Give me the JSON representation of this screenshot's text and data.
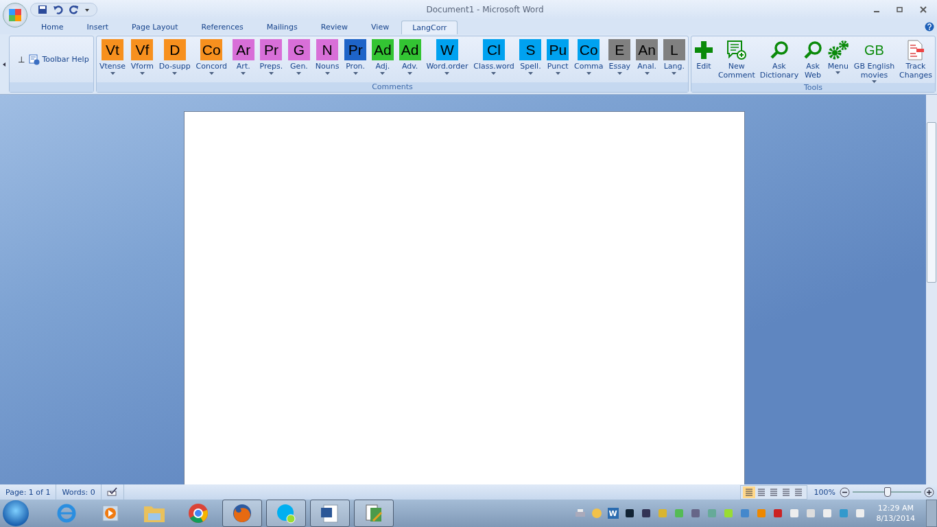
{
  "window": {
    "title": "Document1 - Microsoft Word"
  },
  "tabs": [
    {
      "label": "Home",
      "selected": false
    },
    {
      "label": "Insert",
      "selected": false
    },
    {
      "label": "Page Layout",
      "selected": false
    },
    {
      "label": "References",
      "selected": false
    },
    {
      "label": "Mailings",
      "selected": false
    },
    {
      "label": "Review",
      "selected": false
    },
    {
      "label": "View",
      "selected": false
    },
    {
      "label": "LangCorr",
      "selected": true
    }
  ],
  "help_group": {
    "marker": "⊥",
    "button": "Toolbar Help"
  },
  "comments_group": {
    "label": "Comments",
    "items": [
      {
        "abbr": "Vt",
        "label": "Vtense",
        "color": "#f7901e"
      },
      {
        "abbr": "Vf",
        "label": "Vform",
        "color": "#f7901e"
      },
      {
        "abbr": "D",
        "label": "Do-supp",
        "color": "#f7901e"
      },
      {
        "abbr": "Co",
        "label": "Concord",
        "color": "#f7901e"
      },
      {
        "abbr": "Ar",
        "label": "Art.",
        "color": "#d86fd8"
      },
      {
        "abbr": "Pr",
        "label": "Preps.",
        "color": "#d86fd8"
      },
      {
        "abbr": "G",
        "label": "Gen.",
        "color": "#d86fd8"
      },
      {
        "abbr": "N",
        "label": "Nouns",
        "color": "#d86fd8"
      },
      {
        "abbr": "Pr",
        "label": "Pron.",
        "color": "#1e64c8"
      },
      {
        "abbr": "Ad",
        "label": "Adj.",
        "color": "#33c433"
      },
      {
        "abbr": "Ad",
        "label": "Adv.",
        "color": "#33c433"
      },
      {
        "abbr": "W",
        "label": "Word.order",
        "color": "#00a2f0"
      },
      {
        "abbr": "Cl",
        "label": "Class.word",
        "color": "#00a2f0"
      },
      {
        "abbr": "S",
        "label": "Spell.",
        "color": "#00a2f0"
      },
      {
        "abbr": "Pu",
        "label": "Punct",
        "color": "#00a2f0"
      },
      {
        "abbr": "Co",
        "label": "Comma",
        "color": "#00a2f0"
      },
      {
        "abbr": "E",
        "label": "Essay",
        "color": "#808080"
      },
      {
        "abbr": "An",
        "label": "Anal.",
        "color": "#808080"
      },
      {
        "abbr": "L",
        "label": "Lang.",
        "color": "#808080"
      }
    ]
  },
  "tools_group": {
    "label": "Tools",
    "items": [
      {
        "kind": "plus",
        "lines": [
          "Edit"
        ],
        "dropdown": false
      },
      {
        "kind": "comment",
        "lines": [
          "New",
          "Comment"
        ],
        "dropdown": false
      },
      {
        "kind": "magnifier",
        "lines": [
          "Ask",
          "Dictionary"
        ],
        "dropdown": false
      },
      {
        "kind": "magnifier",
        "lines": [
          "Ask",
          "Web"
        ],
        "dropdown": false
      },
      {
        "kind": "gears",
        "lines": [
          "Menu"
        ],
        "dropdown": true
      },
      {
        "kind": "text",
        "glyph": "GB",
        "lines": [
          "GB English",
          "movies"
        ],
        "dropdown": true
      },
      {
        "kind": "document",
        "lines": [
          "Track",
          "Changes"
        ],
        "dropdown": false
      }
    ]
  },
  "status_bar": {
    "page": "Page: 1 of 1",
    "words": "Words: 0",
    "views": [
      {
        "selected": true
      },
      {
        "selected": false
      },
      {
        "selected": false
      },
      {
        "selected": false
      },
      {
        "selected": false
      }
    ],
    "zoom": "100%",
    "zoom_slider": {
      "level": 0.5
    }
  },
  "taskbar": {
    "apps": [
      {
        "kind": "browser-e",
        "running": false
      },
      {
        "kind": "media",
        "running": false
      },
      {
        "kind": "folder",
        "running": false
      },
      {
        "kind": "chrome",
        "running": false
      },
      {
        "kind": "fox",
        "running": true
      },
      {
        "kind": "chat",
        "running": true
      },
      {
        "kind": "word",
        "running": true
      },
      {
        "kind": "notebook",
        "running": true
      }
    ],
    "tray_word": "W",
    "time": "12:29 AM",
    "date": "8/13/2014"
  }
}
